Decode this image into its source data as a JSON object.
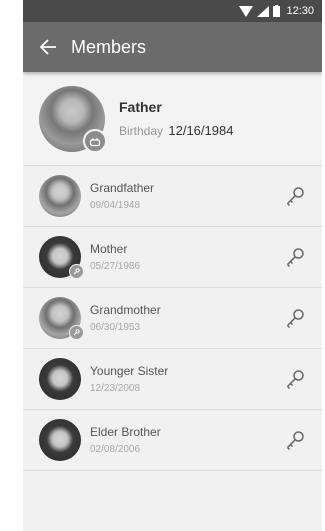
{
  "status_bar": {
    "time": "12:30",
    "icons": [
      "wifi-icon",
      "signal-icon",
      "battery-icon"
    ]
  },
  "app_bar": {
    "title": "Members",
    "back_icon": "back-arrow-icon"
  },
  "owner": {
    "name": "Father",
    "birthday_label": "Birthday",
    "birthday": "12/16/1984",
    "badge_icon": "cake-icon"
  },
  "members": [
    {
      "name": "Grandfather",
      "date": "09/04/1948",
      "action_icon": "key-icon"
    },
    {
      "name": "Mother",
      "date": "05/27/1986",
      "action_icon": "key-icon",
      "avatar_badge": "key-badge-icon"
    },
    {
      "name": "Grandmother",
      "date": "06/30/1953",
      "action_icon": "key-icon",
      "avatar_badge": "key-badge-icon"
    },
    {
      "name": "Younger Sister",
      "date": "12/23/2008",
      "action_icon": "key-icon"
    },
    {
      "name": "Elder Brother",
      "date": "02/08/2006",
      "action_icon": "key-icon"
    }
  ],
  "colors": {
    "status_bar": "#4a4a4a",
    "app_bar": "#6b6b6b",
    "background": "#f1f1f1"
  }
}
